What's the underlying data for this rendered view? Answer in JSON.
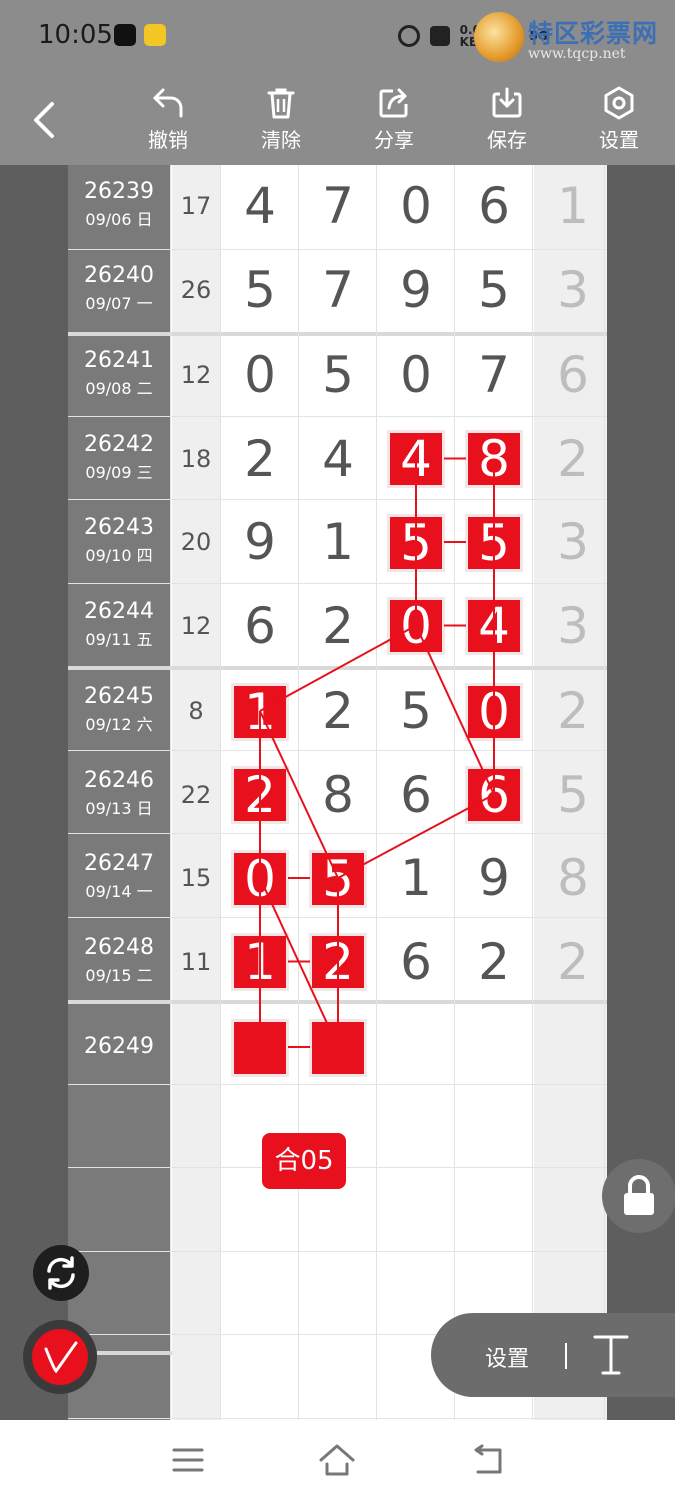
{
  "status": {
    "time": "10:05",
    "speed_value": "0.01",
    "speed_unit": "KB/s",
    "net1": "5G",
    "net2": "5G"
  },
  "watermark": {
    "title": "特区彩票网",
    "url": "www.tqcp.net"
  },
  "toolbar": {
    "undo_label": "撤销",
    "clear_label": "清除",
    "share_label": "分享",
    "save_label": "保存",
    "settings_label": "设置"
  },
  "rows": [
    {
      "issue": "26239",
      "date": "09/06 日",
      "sum": "17",
      "digits": [
        "4",
        "7",
        "0",
        "6"
      ],
      "last": "1",
      "hits": []
    },
    {
      "issue": "26240",
      "date": "09/07 一",
      "sum": "26",
      "digits": [
        "5",
        "7",
        "9",
        "5"
      ],
      "last": "3",
      "hits": []
    },
    {
      "issue": "26241",
      "date": "09/08 二",
      "sum": "12",
      "digits": [
        "0",
        "5",
        "0",
        "7"
      ],
      "last": "6",
      "hits": []
    },
    {
      "issue": "26242",
      "date": "09/09 三",
      "sum": "18",
      "digits": [
        "2",
        "4",
        "4",
        "8"
      ],
      "last": "2",
      "hits": [
        2,
        3
      ]
    },
    {
      "issue": "26243",
      "date": "09/10 四",
      "sum": "20",
      "digits": [
        "9",
        "1",
        "5",
        "5"
      ],
      "last": "3",
      "hits": [
        2,
        3
      ]
    },
    {
      "issue": "26244",
      "date": "09/11 五",
      "sum": "12",
      "digits": [
        "6",
        "2",
        "0",
        "4"
      ],
      "last": "3",
      "hits": [
        2,
        3
      ]
    },
    {
      "issue": "26245",
      "date": "09/12 六",
      "sum": "8",
      "digits": [
        "1",
        "2",
        "5",
        "0"
      ],
      "last": "2",
      "hits": [
        0,
        3
      ]
    },
    {
      "issue": "26246",
      "date": "09/13 日",
      "sum": "22",
      "digits": [
        "2",
        "8",
        "6",
        "6"
      ],
      "last": "5",
      "hits": [
        0,
        3
      ]
    },
    {
      "issue": "26247",
      "date": "09/14 一",
      "sum": "15",
      "digits": [
        "0",
        "5",
        "1",
        "9"
      ],
      "last": "8",
      "hits": [
        0,
        1
      ]
    },
    {
      "issue": "26248",
      "date": "09/15 二",
      "sum": "11",
      "digits": [
        "1",
        "2",
        "6",
        "2"
      ],
      "last": "2",
      "hits": [
        0,
        1
      ]
    },
    {
      "issue": "26249",
      "date": "",
      "sum": "",
      "digits": [
        "",
        "",
        "",
        ""
      ],
      "last": "",
      "hits": [
        0,
        1
      ]
    }
  ],
  "he_badge": "合05",
  "floating": {
    "settings_label": "设置",
    "text_tool_glyph": "T"
  },
  "colors": {
    "accent_red": "#e8101c",
    "toolbar_gray": "#8c8c8c",
    "board_bg": "#ffffff"
  },
  "icons": [
    "back-icon",
    "undo-icon",
    "trash-icon",
    "share-icon",
    "download-icon",
    "gear-icon",
    "lock-icon",
    "refresh-icon",
    "pen-icon",
    "text-icon",
    "menu-icon",
    "home-icon",
    "return-icon"
  ]
}
